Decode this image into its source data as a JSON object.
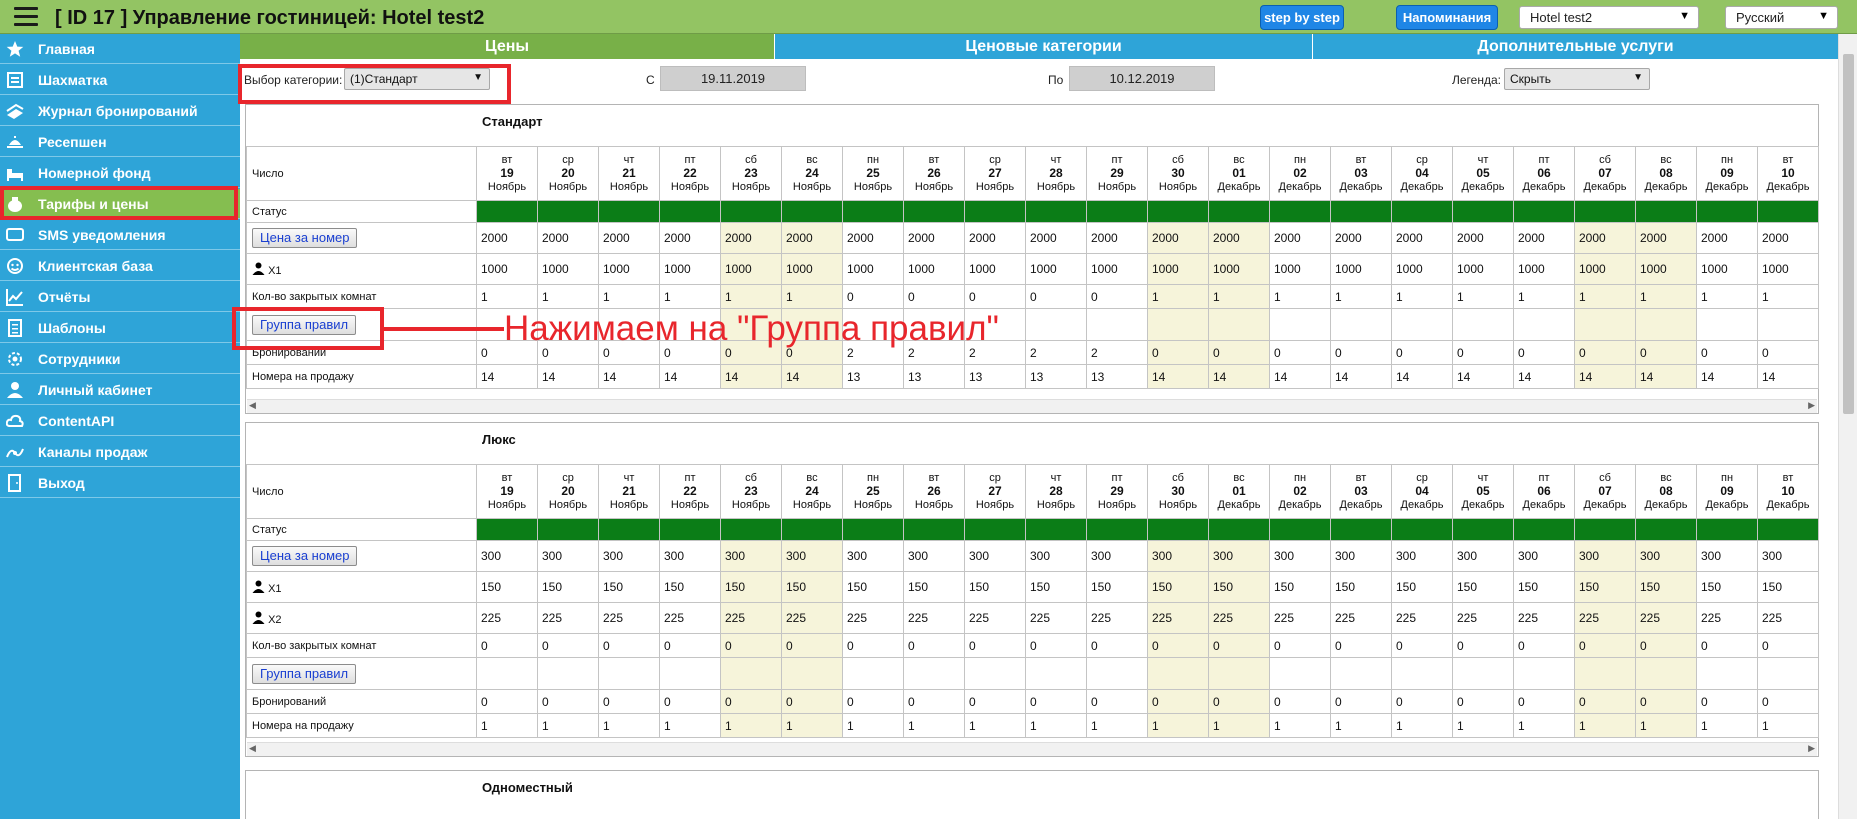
{
  "app": {
    "title": "[ ID 17 ] Управление гостиницей: Hotel test2",
    "step_by_step_label": "step by step",
    "reminders_label": "Напоминания",
    "hotel_select_value": "Hotel test2",
    "language_select_value": "Русский"
  },
  "sidebar": {
    "items": [
      {
        "label": "Главная",
        "icon": "star-icon"
      },
      {
        "label": "Шахматка",
        "icon": "chessboard-icon"
      },
      {
        "label": "Журнал бронирований",
        "icon": "journal-icon"
      },
      {
        "label": "Ресепшен",
        "icon": "reception-bell-icon"
      },
      {
        "label": "Номерной фонд",
        "icon": "bed-icon"
      },
      {
        "label": "Тарифы и цены",
        "icon": "money-bag-icon",
        "active": true
      },
      {
        "label": "SMS уведомления",
        "icon": "sms-icon"
      },
      {
        "label": "Клиентская база",
        "icon": "client-face-icon"
      },
      {
        "label": "Отчёты",
        "icon": "chart-line-icon"
      },
      {
        "label": "Шаблоны",
        "icon": "template-icon"
      },
      {
        "label": "Сотрудники",
        "icon": "gear-icon"
      },
      {
        "label": "Личный кабинет",
        "icon": "user-icon"
      },
      {
        "label": "ContentAPI",
        "icon": "cloud-icon"
      },
      {
        "label": "Каналы продаж",
        "icon": "channels-icon"
      },
      {
        "label": "Выход",
        "icon": "exit-icon"
      }
    ]
  },
  "tabs": [
    {
      "label": "Цены",
      "active": true
    },
    {
      "label": "Ценовые категории"
    },
    {
      "label": "Дополнительные услуги"
    }
  ],
  "filters": {
    "category_label": "Выбор категории:",
    "category_value": "(1)Стандарт",
    "from_label": "С",
    "from_value": "19.11.2019",
    "to_label": "По",
    "to_value": "10.12.2019",
    "legend_label": "Легенда:",
    "legend_value": "Скрыть"
  },
  "days": [
    {
      "dow": "вт",
      "day": "19",
      "month": "Ноябрь"
    },
    {
      "dow": "ср",
      "day": "20",
      "month": "Ноябрь"
    },
    {
      "dow": "чт",
      "day": "21",
      "month": "Ноябрь"
    },
    {
      "dow": "пт",
      "day": "22",
      "month": "Ноябрь"
    },
    {
      "dow": "сб",
      "day": "23",
      "month": "Ноябрь",
      "weekend": true
    },
    {
      "dow": "вс",
      "day": "24",
      "month": "Ноябрь",
      "weekend": true
    },
    {
      "dow": "пн",
      "day": "25",
      "month": "Ноябрь"
    },
    {
      "dow": "вт",
      "day": "26",
      "month": "Ноябрь"
    },
    {
      "dow": "ср",
      "day": "27",
      "month": "Ноябрь"
    },
    {
      "dow": "чт",
      "day": "28",
      "month": "Ноябрь"
    },
    {
      "dow": "пт",
      "day": "29",
      "month": "Ноябрь"
    },
    {
      "dow": "сб",
      "day": "30",
      "month": "Ноябрь",
      "weekend": true
    },
    {
      "dow": "вс",
      "day": "01",
      "month": "Декабрь",
      "weekend": true
    },
    {
      "dow": "пн",
      "day": "02",
      "month": "Декабрь"
    },
    {
      "dow": "вт",
      "day": "03",
      "month": "Декабрь"
    },
    {
      "dow": "ср",
      "day": "04",
      "month": "Декабрь"
    },
    {
      "dow": "чт",
      "day": "05",
      "month": "Декабрь"
    },
    {
      "dow": "пт",
      "day": "06",
      "month": "Декабрь"
    },
    {
      "dow": "сб",
      "day": "07",
      "month": "Декабрь",
      "weekend": true
    },
    {
      "dow": "вс",
      "day": "08",
      "month": "Декабрь",
      "weekend": true
    },
    {
      "dow": "пн",
      "day": "09",
      "month": "Декабрь"
    },
    {
      "dow": "вт",
      "day": "10",
      "month": "Декабрь"
    }
  ],
  "labels": {
    "number": "Число",
    "status": "Статус",
    "room_price_btn": "Цена за номер",
    "x1": "X1",
    "x2": "X2",
    "closed_rooms": "Кол-во закрытых комнат",
    "rules_group_btn": "Группа правил",
    "bookings": "Бронирований",
    "rooms_for_sale": "Номера на продажу"
  },
  "categories": [
    {
      "name": "Стандарт",
      "price": [
        "2000",
        "2000",
        "2000",
        "2000",
        "2000",
        "2000",
        "2000",
        "2000",
        "2000",
        "2000",
        "2000",
        "2000",
        "2000",
        "2000",
        "2000",
        "2000",
        "2000",
        "2000",
        "2000",
        "2000",
        "2000",
        "2000"
      ],
      "occupancy": [
        {
          "label": "X1",
          "values": [
            "1000",
            "1000",
            "1000",
            "1000",
            "1000",
            "1000",
            "1000",
            "1000",
            "1000",
            "1000",
            "1000",
            "1000",
            "1000",
            "1000",
            "1000",
            "1000",
            "1000",
            "1000",
            "1000",
            "1000",
            "1000",
            "1000"
          ]
        }
      ],
      "closed": [
        "1",
        "1",
        "1",
        "1",
        "1",
        "1",
        "0",
        "0",
        "0",
        "0",
        "0",
        "1",
        "1",
        "1",
        "1",
        "1",
        "1",
        "1",
        "1",
        "1",
        "1",
        "1"
      ],
      "bookings": [
        "0",
        "0",
        "0",
        "0",
        "0",
        "0",
        "2",
        "2",
        "2",
        "2",
        "2",
        "0",
        "0",
        "0",
        "0",
        "0",
        "0",
        "0",
        "0",
        "0",
        "0",
        "0"
      ],
      "for_sale": [
        "14",
        "14",
        "14",
        "14",
        "14",
        "14",
        "13",
        "13",
        "13",
        "13",
        "13",
        "14",
        "14",
        "14",
        "14",
        "14",
        "14",
        "14",
        "14",
        "14",
        "14",
        "14"
      ]
    },
    {
      "name": "Люкс",
      "price": [
        "300",
        "300",
        "300",
        "300",
        "300",
        "300",
        "300",
        "300",
        "300",
        "300",
        "300",
        "300",
        "300",
        "300",
        "300",
        "300",
        "300",
        "300",
        "300",
        "300",
        "300",
        "300"
      ],
      "occupancy": [
        {
          "label": "X1",
          "values": [
            "150",
            "150",
            "150",
            "150",
            "150",
            "150",
            "150",
            "150",
            "150",
            "150",
            "150",
            "150",
            "150",
            "150",
            "150",
            "150",
            "150",
            "150",
            "150",
            "150",
            "150",
            "150"
          ]
        },
        {
          "label": "X2",
          "values": [
            "225",
            "225",
            "225",
            "225",
            "225",
            "225",
            "225",
            "225",
            "225",
            "225",
            "225",
            "225",
            "225",
            "225",
            "225",
            "225",
            "225",
            "225",
            "225",
            "225",
            "225",
            "225"
          ]
        }
      ],
      "closed": [
        "0",
        "0",
        "0",
        "0",
        "0",
        "0",
        "0",
        "0",
        "0",
        "0",
        "0",
        "0",
        "0",
        "0",
        "0",
        "0",
        "0",
        "0",
        "0",
        "0",
        "0",
        "0"
      ],
      "bookings": [
        "0",
        "0",
        "0",
        "0",
        "0",
        "0",
        "0",
        "0",
        "0",
        "0",
        "0",
        "0",
        "0",
        "0",
        "0",
        "0",
        "0",
        "0",
        "0",
        "0",
        "0",
        "0"
      ],
      "for_sale": [
        "1",
        "1",
        "1",
        "1",
        "1",
        "1",
        "1",
        "1",
        "1",
        "1",
        "1",
        "1",
        "1",
        "1",
        "1",
        "1",
        "1",
        "1",
        "1",
        "1",
        "1",
        "1"
      ]
    },
    {
      "name": "Одноместный"
    }
  ],
  "annotation": {
    "text": "Нажимаем на \"Группа правил\"",
    "color": "#e8262c"
  },
  "colors": {
    "topbar": "#93c463",
    "sidebar": "#2ea4d8",
    "active_item": "#85be50",
    "status_free": "#0b7d17",
    "weekend": "#f6f4da",
    "primary_button": "#1f86e6"
  }
}
